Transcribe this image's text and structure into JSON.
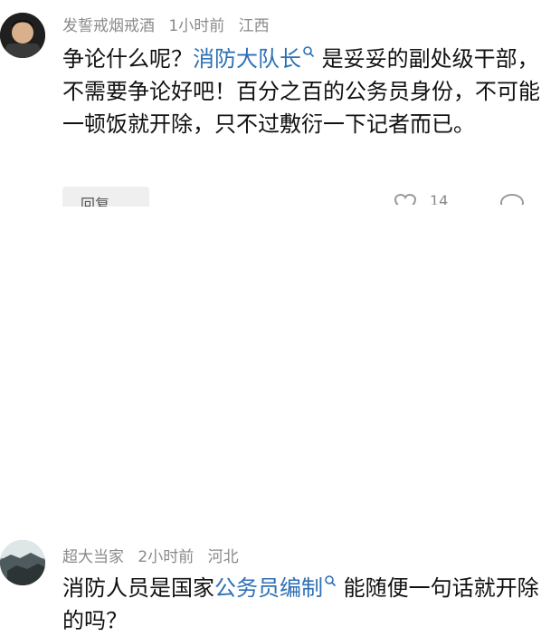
{
  "comments": [
    {
      "username": "发誓戒烟戒酒",
      "time": "1小时前",
      "location": "江西",
      "body_parts": [
        "争论什么呢？",
        "消防大队长",
        "是妥妥的副处级干部，不需要争论好吧！百分之百的公务员身份，不可能一顿饭就开除，只不过敷衍一下记者而已。"
      ],
      "reply_label": "回复",
      "like_count": "14"
    },
    {
      "username": "超大当家",
      "time": "2小时前",
      "location": "河北",
      "body_parts": [
        "消防人员是国家",
        "公务员编制",
        "能随便一句话就开除的吗？"
      ]
    }
  ],
  "colors": {
    "link": "#2d6fb5",
    "meta": "#8a8a8a"
  }
}
